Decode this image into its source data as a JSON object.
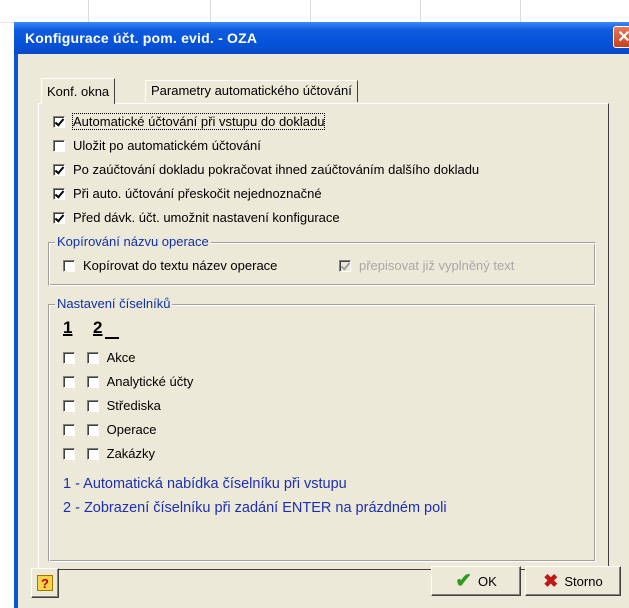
{
  "window": {
    "title": "Konfigurace účt. pom. evid. - OZA",
    "close_label": "✕"
  },
  "tabs": [
    {
      "label": "Konf. okna",
      "active": true
    },
    {
      "label": "Parametry automatického účtování",
      "active": false
    }
  ],
  "options": [
    {
      "label": "Automatické účtování při vstupu do dokladu",
      "checked": true
    },
    {
      "label": "Uložit po automatickém účtování",
      "checked": false
    },
    {
      "label": "Po zaúčtování dokladu pokračovat ihned zaúčtováním dalšího dokladu",
      "checked": true
    },
    {
      "label": "Při auto. účtování přeskočit nejednoznačné",
      "checked": true
    },
    {
      "label": "Před dávk. účt. umožnit nastavení konfigurace",
      "checked": true
    }
  ],
  "copy_group": {
    "title": "Kopírování názvu operace",
    "copy_label": "Kopírovat do textu název operace",
    "overwrite_label": "přepisovat již vyplněný text"
  },
  "codelist_group": {
    "title": "Nastavení číselníků",
    "col1": "1",
    "col2": "2",
    "items": [
      "Akce",
      "Analytické účty",
      "Střediska",
      "Operace",
      "Zakázky"
    ],
    "legend1": "1 - Automatická nabídka číselníku při vstupu",
    "legend2": "2 - Zobrazení číselníku při zadání ENTER na prázdném poli"
  },
  "buttons": {
    "help": "?",
    "ok": "OK",
    "storno": "Storno"
  },
  "colors": {
    "title_bar": "#0552d8",
    "dialog_bg": "#ece9d8",
    "legend_text": "#1d2fb0"
  }
}
